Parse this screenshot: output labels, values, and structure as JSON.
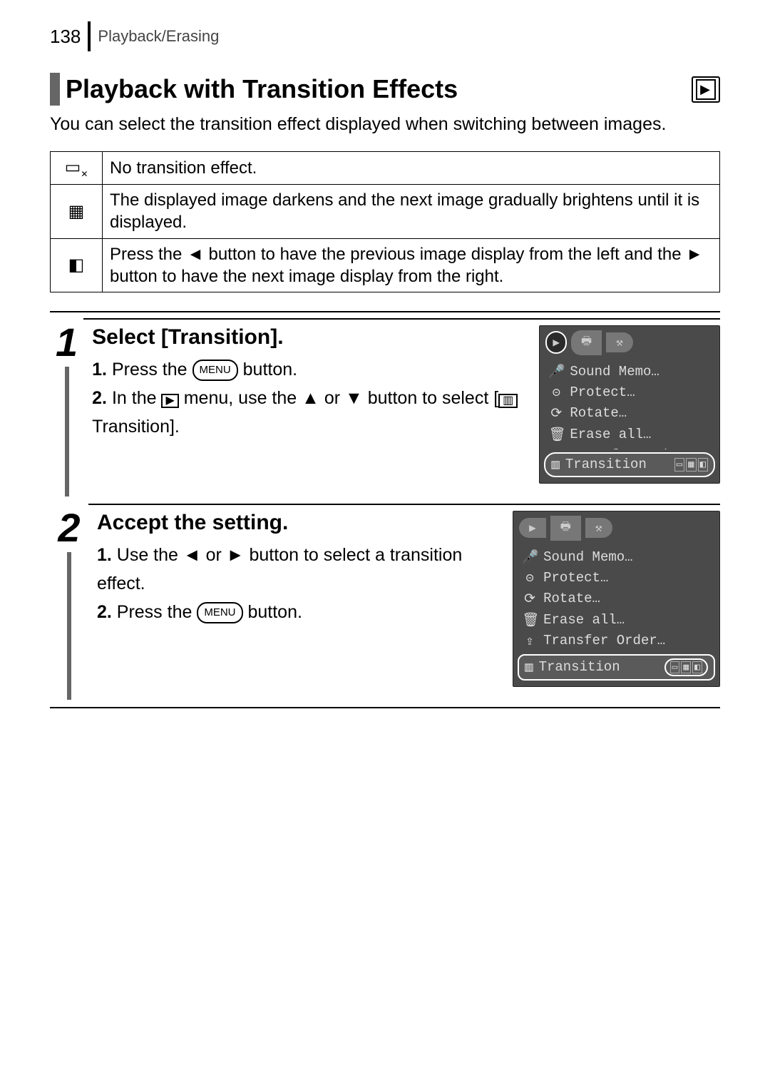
{
  "header": {
    "page_number": "138",
    "breadcrumb": "Playback/Erasing"
  },
  "title": "Playback with Transition Effects",
  "intro": "You can select the transition effect displayed when switching between images.",
  "fx": {
    "row1": "No transition effect.",
    "row2": "The displayed image darkens and the next image gradually brightens until it is displayed.",
    "row3_a": "Press the",
    "row3_b": "button to have the previous image display from the left and the",
    "row3_c": "button to have the next image display from the right."
  },
  "step1": {
    "num": "1",
    "title": "Select [Transition].",
    "line1_a": "Press the",
    "line1_b": "button.",
    "line2_a": "In the",
    "line2_b": "menu, use the",
    "line2_c": "or",
    "line2_d": "button to select [",
    "line2_e": "Transition].",
    "menu_label": "MENU"
  },
  "step2": {
    "num": "2",
    "title": "Accept the setting.",
    "line1_a": "Use the",
    "line1_b": "or",
    "line1_c": "button to select a transition effect.",
    "line2_a": "Press the",
    "line2_b": "button.",
    "menu_label": "MENU"
  },
  "cam_menu": {
    "tab_play": "▶",
    "tab_print": "🖶",
    "tab_tools": "⚒",
    "items": {
      "sound_memo": "Sound Memo…",
      "protect": "Protect…",
      "rotate": "Rotate…",
      "erase_all": "Erase all…",
      "transfer_order": "Transfer Order…",
      "transition": "Transition"
    }
  }
}
